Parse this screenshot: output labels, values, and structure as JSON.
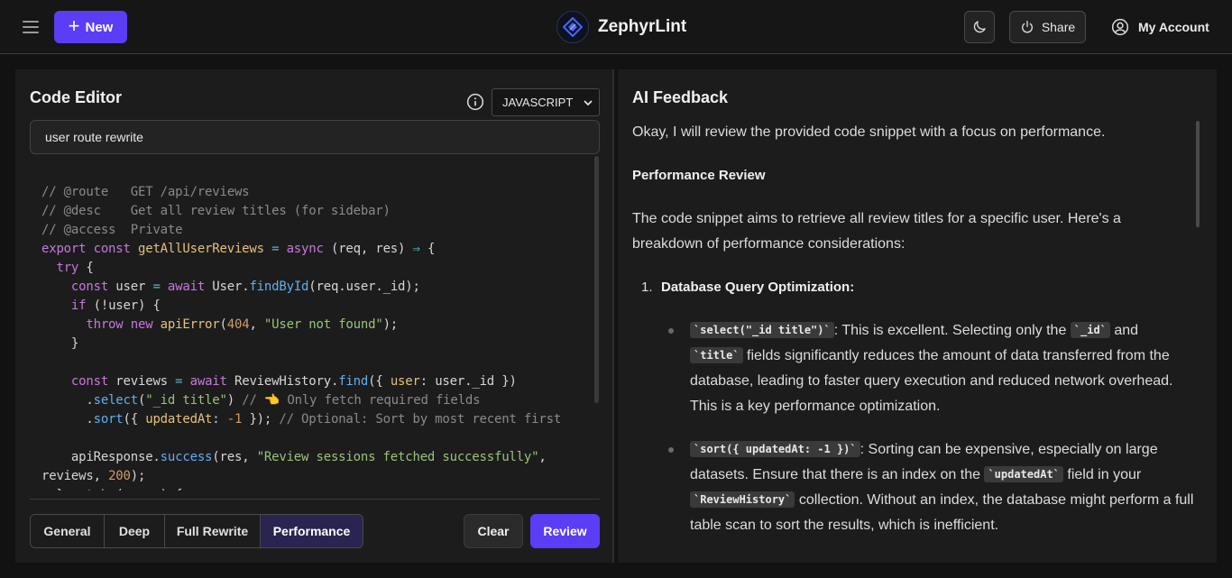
{
  "header": {
    "new_label": "New",
    "brand_name": "ZephyrLint",
    "share_label": "Share",
    "account_label": "My Account"
  },
  "editor": {
    "title": "Code Editor",
    "language": "JAVASCRIPT",
    "title_input_value": "user route rewrite",
    "mode_tabs": [
      {
        "label": "General",
        "active": false
      },
      {
        "label": "Deep",
        "active": false
      },
      {
        "label": "Full Rewrite",
        "active": false
      },
      {
        "label": "Performance",
        "active": true
      }
    ],
    "clear_label": "Clear",
    "review_label": "Review"
  },
  "feedback": {
    "title": "AI Feedback",
    "intro": "Okay, I will review the provided code snippet with a focus on performance.",
    "heading": "Performance Review",
    "summary": "The code snippet aims to retrieve all review titles for a specific user. Here's a breakdown of performance considerations:",
    "item1_number": "1.",
    "item1_title": "Database Query Optimization:",
    "b1_code": "`select(\"_id title\")`",
    "b1_t1": ": This is excellent. Selecting only the ",
    "b1_code2": "`_id`",
    "b1_t2": " and ",
    "b1_code3": "`title`",
    "b1_t3": " fields significantly reduces the amount of data transferred from the database, leading to faster query execution and reduced network overhead. This is a key performance optimization.",
    "b2_code": "`sort({ updatedAt: -1 })`",
    "b2_t1": ": Sorting can be expensive, especially on large datasets. Ensure that there is an index on the ",
    "b2_code2": "`updatedAt`",
    "b2_t2": " field in your ",
    "b2_code3": "`ReviewHistory`",
    "b2_t3": " collection. Without an index, the database might perform a full table scan to sort the results, which is inefficient."
  },
  "icons": {
    "menu": "hamburger-icon",
    "new": "plus-icon",
    "logo": "zephyrlint-logo",
    "theme": "moon-icon",
    "share": "power-icon",
    "account": "user-circle-icon",
    "info": "info-icon"
  },
  "colors": {
    "accent": "#5b3df5",
    "active_tab": "#2a2450",
    "background": "#121212",
    "panel": "#1c1c1c"
  }
}
